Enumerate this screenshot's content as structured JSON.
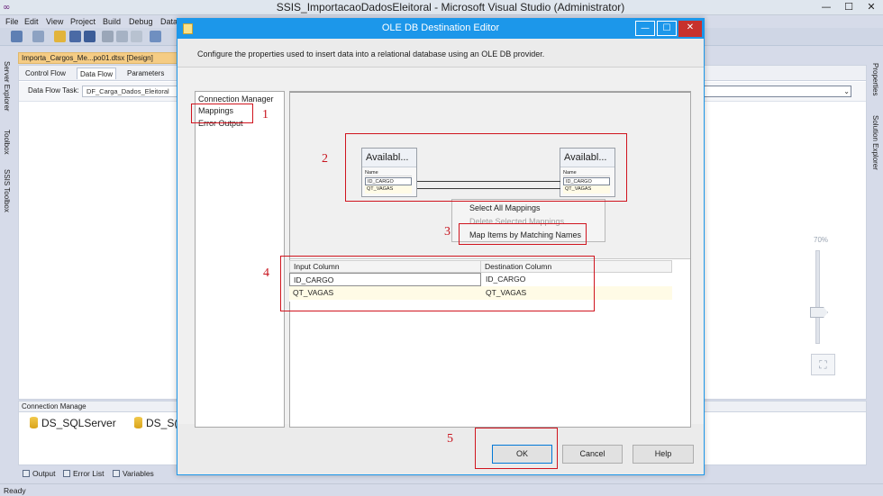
{
  "vs": {
    "title": "SSIS_ImportacaoDadosEleitoral - Microsoft Visual Studio (Administrator)",
    "icon": "visual-studio-icon",
    "menu": [
      "File",
      "Edit",
      "View",
      "Project",
      "Build",
      "Debug",
      "Data"
    ],
    "document_tab": "Importa_Cargos_Me...po01.dtsx [Design]",
    "designer_tabs": [
      "Control Flow",
      "Data Flow",
      "Parameters"
    ],
    "data_flow_task_label": "Data Flow Task:",
    "data_flow_task_value": "DF_Carga_Dados_Eleitoral",
    "left_tool_windows": [
      "Server Explorer",
      "Toolbox",
      "SSIS Toolbox"
    ],
    "right_tool_windows": [
      "Properties",
      "Solution Explorer"
    ],
    "zoom": "70%",
    "zoom_level_percent": 70,
    "connection_managers_header": "Connection Manage",
    "connection_managers": [
      "DS_SQLServer",
      "DS_S("
    ],
    "bottom_tabs": [
      "Output",
      "Error List",
      "Variables"
    ],
    "status": "Ready"
  },
  "dialog": {
    "title": "OLE DB Destination Editor",
    "description": "Configure the properties used to insert data into a relational database using an OLE DB provider.",
    "nav_items": [
      "Connection Manager",
      "Mappings",
      "Error Output"
    ],
    "mapping": {
      "input_table_title": "Availabl...",
      "destination_table_title": "Availabl...",
      "column_header": "Name",
      "input_columns": [
        "ID_CARGO",
        "QT_VAGAS"
      ],
      "destination_columns": [
        "ID_CARGO",
        "QT_VAGAS"
      ]
    },
    "context_menu": {
      "select_all": "Select All Mappings",
      "delete_selected": "Delete Selected Mappings",
      "map_by_name": "Map Items by Matching Names"
    },
    "grid": {
      "headers": [
        "Input Column",
        "Destination Column"
      ],
      "rows": [
        {
          "input": "ID_CARGO",
          "destination": "ID_CARGO"
        },
        {
          "input": "QT_VAGAS",
          "destination": "QT_VAGAS"
        }
      ]
    },
    "buttons": {
      "ok": "OK",
      "cancel": "Cancel",
      "help": "Help"
    }
  },
  "annotations": [
    "1",
    "2",
    "3",
    "4",
    "5"
  ],
  "colors": {
    "accent": "#1c97ea",
    "annotation": "#d0141e",
    "tab_highlight": "#f5cc84"
  }
}
